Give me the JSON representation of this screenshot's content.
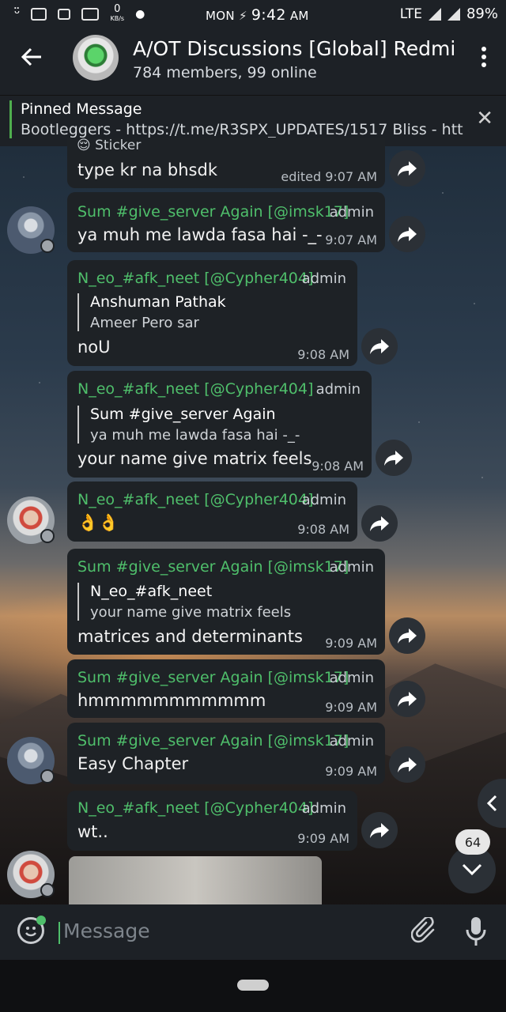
{
  "status_bar": {
    "day": "MON",
    "time": "9:42",
    "ampm": "AM",
    "speed_value": "0",
    "speed_unit": "KB/s",
    "network": "LTE",
    "battery": "89%"
  },
  "header": {
    "title": "A/OT Discussions [Global]    Redmi",
    "subtitle": "784 members, 99 online"
  },
  "pinned": {
    "title": "Pinned Message",
    "text": "Bootleggers - https://t.me/R3SPX_UPDATES/1517 Bliss - http..."
  },
  "messages": [
    {
      "sticker_label": "Sticker",
      "text": "type kr na bhsdk",
      "time": "edited 9:07 AM"
    },
    {
      "sender": "Sum #give_server Again [@imsk17]",
      "role": "admin",
      "text": "ya muh me lawda fasa hai -_-",
      "time": "9:07 AM"
    },
    {
      "sender": "N_eo_#afk_neet [@Cypher404]",
      "role": "admin",
      "reply_sender": "Anshuman Pathak",
      "reply_text": "Ameer Pero sar",
      "text": "noU",
      "time": "9:08 AM"
    },
    {
      "sender": "N_eo_#afk_neet [@Cypher404]",
      "role": "admin",
      "reply_sender": "Sum #give_server Again",
      "reply_text": "ya muh me lawda fasa hai -_-",
      "text": "your name give matrix feels",
      "time": "9:08 AM"
    },
    {
      "sender": "N_eo_#afk_neet [@Cypher404]",
      "role": "admin",
      "text": "👌👌",
      "time": "9:08 AM"
    },
    {
      "sender": "Sum #give_server Again [@imsk17]",
      "role": "admin",
      "reply_sender": "N_eo_#afk_neet",
      "reply_text": "your name give matrix feels",
      "text": "matrices and determinants",
      "time": "9:09 AM"
    },
    {
      "sender": "Sum #give_server Again [@imsk17]",
      "role": "admin",
      "text": "hmmmmmmmmmmm",
      "time": "9:09 AM"
    },
    {
      "sender": "Sum #give_server Again [@imsk17]",
      "role": "admin",
      "text": "Easy Chapter",
      "time": "9:09 AM"
    },
    {
      "sender": "N_eo_#afk_neet [@Cypher404]",
      "role": "admin",
      "text": "wt..",
      "time": "9:09 AM"
    }
  ],
  "unread_count": "64",
  "input": {
    "placeholder": "Message"
  },
  "colors": {
    "accent": "#4fbf6b",
    "bubble": "#1e2226",
    "bar": "#1d2126"
  }
}
